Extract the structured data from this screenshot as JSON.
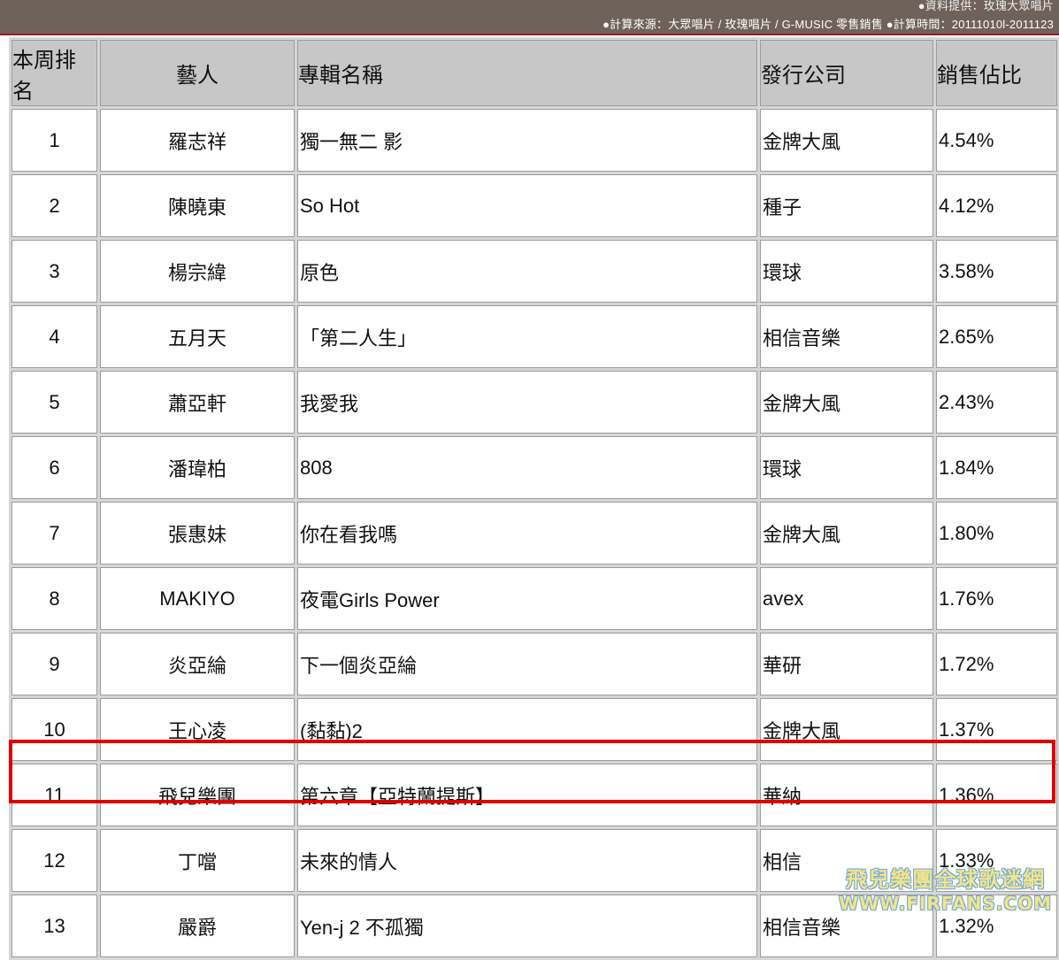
{
  "header": {
    "line1": "●資料提供：玫瑰大眾唱片",
    "line2": "●計算來源：大眾唱片 / 玫瑰唱片 / G-MUSIC 零售銷售 ●計算時間：20111010l-2011123"
  },
  "table": {
    "columns": [
      "本周排名",
      "藝人",
      "專輯名稱",
      "發行公司",
      "銷售佔比"
    ],
    "rows": [
      {
        "rank": "1",
        "artist": "羅志祥",
        "album": "獨一無二 影",
        "label": "金牌大風",
        "share": "4.54%"
      },
      {
        "rank": "2",
        "artist": "陳曉東",
        "album": "So Hot",
        "label": "種子",
        "share": "4.12%"
      },
      {
        "rank": "3",
        "artist": "楊宗緯",
        "album": "原色",
        "label": "環球",
        "share": "3.58%"
      },
      {
        "rank": "4",
        "artist": "五月天",
        "album": "「第二人生」",
        "label": "相信音樂",
        "share": "2.65%"
      },
      {
        "rank": "5",
        "artist": "蕭亞軒",
        "album": "我愛我",
        "label": "金牌大風",
        "share": "2.43%"
      },
      {
        "rank": "6",
        "artist": "潘瑋柏",
        "album": "808",
        "label": "環球",
        "share": "1.84%"
      },
      {
        "rank": "7",
        "artist": "張惠妹",
        "album": "你在看我嗎",
        "label": "金牌大風",
        "share": "1.80%"
      },
      {
        "rank": "8",
        "artist": "MAKIYO",
        "album": "夜電Girls Power",
        "label": "avex",
        "share": "1.76%"
      },
      {
        "rank": "9",
        "artist": "炎亞綸",
        "album": "下一個炎亞綸",
        "label": "華研",
        "share": "1.72%"
      },
      {
        "rank": "10",
        "artist": "王心凌",
        "album": "(黏黏)2",
        "label": "金牌大風",
        "share": "1.37%"
      },
      {
        "rank": "11",
        "artist": "飛兒樂團",
        "album": "第六章【亞特蘭提斯】",
        "label": "華納",
        "share": "1.36%"
      },
      {
        "rank": "12",
        "artist": "丁噹",
        "album": "未來的情人",
        "label": "相信",
        "share": "1.33%"
      },
      {
        "rank": "13",
        "artist": "嚴爵",
        "album": "Yen-j 2 不孤獨",
        "label": "相信音樂",
        "share": "1.32%"
      }
    ]
  },
  "highlight": {
    "rank": "11",
    "color": "#e00000"
  },
  "watermark": {
    "line1": "飛兒樂團全球歌迷網",
    "line2": "WWW.FIRFANS.COM"
  }
}
